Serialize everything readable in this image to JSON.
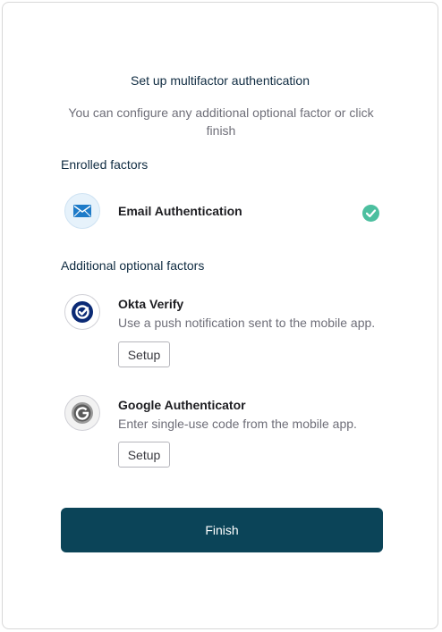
{
  "header": {
    "title": "Set up multifactor authentication",
    "subtitle": "You can configure any additional optional factor or click finish"
  },
  "enrolled": {
    "heading": "Enrolled factors",
    "factors": [
      {
        "name": "Email Authentication",
        "icon": "email-icon",
        "status": "enrolled",
        "status_icon": "check-circle-icon"
      }
    ]
  },
  "optional": {
    "heading": "Additional optional factors",
    "factors": [
      {
        "name": "Okta Verify",
        "description": "Use a push notification sent to the mobile app.",
        "icon": "okta-verify-icon",
        "button_label": "Setup"
      },
      {
        "name": "Google Authenticator",
        "description": "Enter single-use code from the mobile app.",
        "icon": "google-authenticator-icon",
        "button_label": "Setup"
      }
    ]
  },
  "footer": {
    "finish_label": "Finish"
  },
  "colors": {
    "primary": "#0b4458",
    "heading": "#0f2b41",
    "success": "#4cbf9f",
    "muted_text": "#6e6e78"
  }
}
